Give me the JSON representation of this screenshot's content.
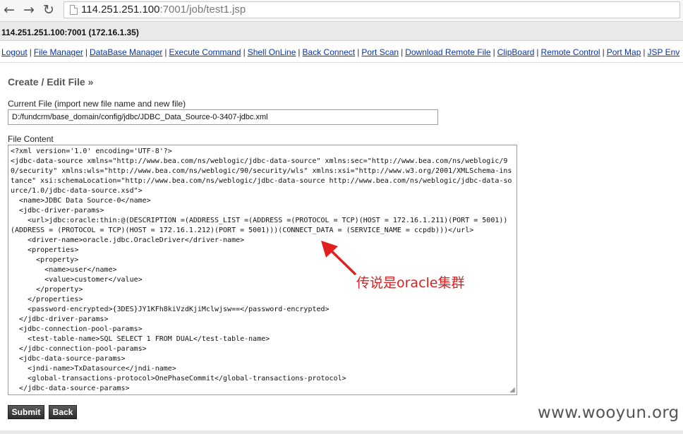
{
  "browser": {
    "url_host": "114.251.251.100",
    "url_rest": ":7001/job/test1.jsp"
  },
  "server": {
    "label": "114.251.251.100:7001 (172.16.1.35)"
  },
  "menu": {
    "items": [
      "Logout",
      "File Manager",
      "DataBase Manager",
      "Execute Command",
      "Shell OnLine",
      "Back Connect",
      "Port Scan",
      "Download Remote File",
      "ClipBoard",
      "Remote Control",
      "Port Map",
      "JSP Env"
    ],
    "separator": "|"
  },
  "editor": {
    "title": "Create / Edit File »",
    "current_file_label": "Current File (import new file name and new file)",
    "current_file_value": "D:/fundcrm/base_domain/config/jdbc/JDBC_Data_Source-0-3407-jdbc.xml",
    "file_content_label": "File Content",
    "file_content": "<?xml version='1.0' encoding='UTF-8'?>\n<jdbc-data-source xmlns=\"http://www.bea.com/ns/weblogic/jdbc-data-source\" xmlns:sec=\"http://www.bea.com/ns/weblogic/90/security\" xmlns:wls=\"http://www.bea.com/ns/weblogic/90/security/wls\" xmlns:xsi=\"http://www.w3.org/2001/XMLSchema-instance\" xsi:schemaLocation=\"http://www.bea.com/ns/weblogic/jdbc-data-source http://www.bea.com/ns/weblogic/jdbc-data-source/1.0/jdbc-data-source.xsd\">\n  <name>JDBC Data Source-0</name>\n  <jdbc-driver-params>\n    <url>jdbc:oracle:thin:@(DESCRIPTION =(ADDRESS_LIST =(ADDRESS =(PROTOCOL = TCP)(HOST = 172.16.1.211)(PORT = 5001))(ADDRESS = (PROTOCOL = TCP)(HOST = 172.16.1.212)(PORT = 5001)))(CONNECT_DATA = (SERVICE_NAME = ccpdb)))</url>\n    <driver-name>oracle.jdbc.OracleDriver</driver-name>\n    <properties>\n      <property>\n        <name>user</name>\n        <value>customer</value>\n      </property>\n    </properties>\n    <password-encrypted>{3DES}JY1KFh8kiVzdKjiMclwjsw==</password-encrypted>\n  </jdbc-driver-params>\n  <jdbc-connection-pool-params>\n    <test-table-name>SQL SELECT 1 FROM DUAL</test-table-name>\n  </jdbc-connection-pool-params>\n  <jdbc-data-source-params>\n    <jndi-name>TxDatasource</jndi-name>\n    <global-transactions-protocol>OnePhaseCommit</global-transactions-protocol>\n  </jdbc-data-source-params>\n</jdbc-data-source>",
    "submit_label": "Submit",
    "back_label": "Back"
  },
  "annotation": {
    "text": "传说是oracle集群",
    "color": "#e0201f"
  },
  "watermark": {
    "text": "www.wooyun.org"
  },
  "icons": {
    "back": "arrow-left-icon",
    "forward": "arrow-right-icon",
    "reload": "reload-icon",
    "page": "page-icon"
  }
}
